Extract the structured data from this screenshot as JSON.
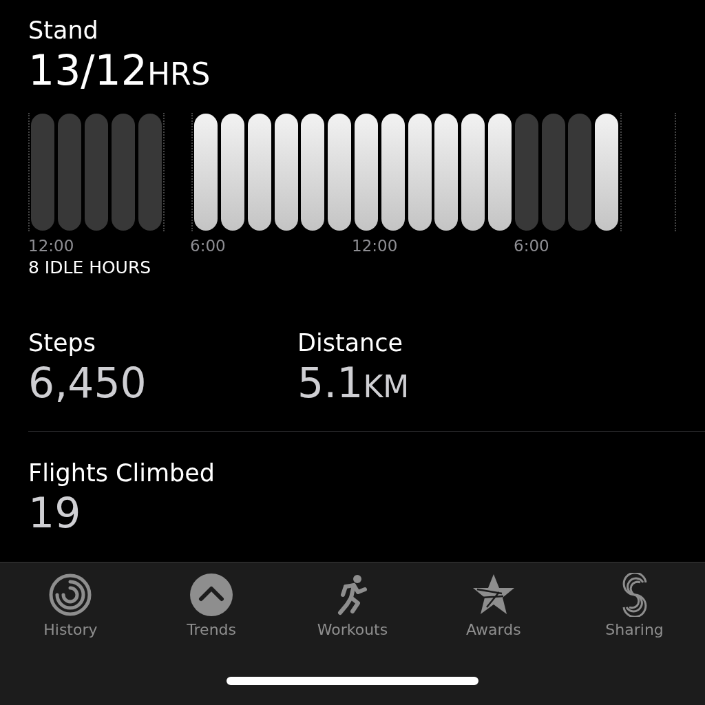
{
  "stand": {
    "title": "Stand",
    "value": "13/12",
    "unit": "HRS",
    "hours": [
      {
        "kind": "idle"
      },
      {
        "kind": "idle"
      },
      {
        "kind": "idle"
      },
      {
        "kind": "idle"
      },
      {
        "kind": "idle"
      },
      {
        "kind": "empty"
      },
      {
        "kind": "stood"
      },
      {
        "kind": "stood"
      },
      {
        "kind": "stood"
      },
      {
        "kind": "stood"
      },
      {
        "kind": "stood"
      },
      {
        "kind": "stood"
      },
      {
        "kind": "stood"
      },
      {
        "kind": "stood"
      },
      {
        "kind": "stood"
      },
      {
        "kind": "stood"
      },
      {
        "kind": "stood"
      },
      {
        "kind": "stood"
      },
      {
        "kind": "idle"
      },
      {
        "kind": "idle"
      },
      {
        "kind": "idle"
      },
      {
        "kind": "stood"
      },
      {
        "kind": "empty"
      },
      {
        "kind": "empty"
      }
    ],
    "axis_labels": [
      "12:00",
      "6:00",
      "12:00",
      "6:00"
    ],
    "idle_note": "8 IDLE HOURS"
  },
  "steps": {
    "title": "Steps",
    "value": "6,450"
  },
  "distance": {
    "title": "Distance",
    "value": "5.1",
    "unit": "KM"
  },
  "flights": {
    "title": "Flights Climbed",
    "value": "19"
  },
  "tab_bar": {
    "tabs": [
      {
        "kind": "history",
        "label": "History"
      },
      {
        "kind": "trends",
        "label": "Trends"
      },
      {
        "kind": "workouts",
        "label": "Workouts"
      },
      {
        "kind": "awards",
        "label": "Awards"
      },
      {
        "kind": "sharing",
        "label": "Sharing"
      }
    ]
  }
}
